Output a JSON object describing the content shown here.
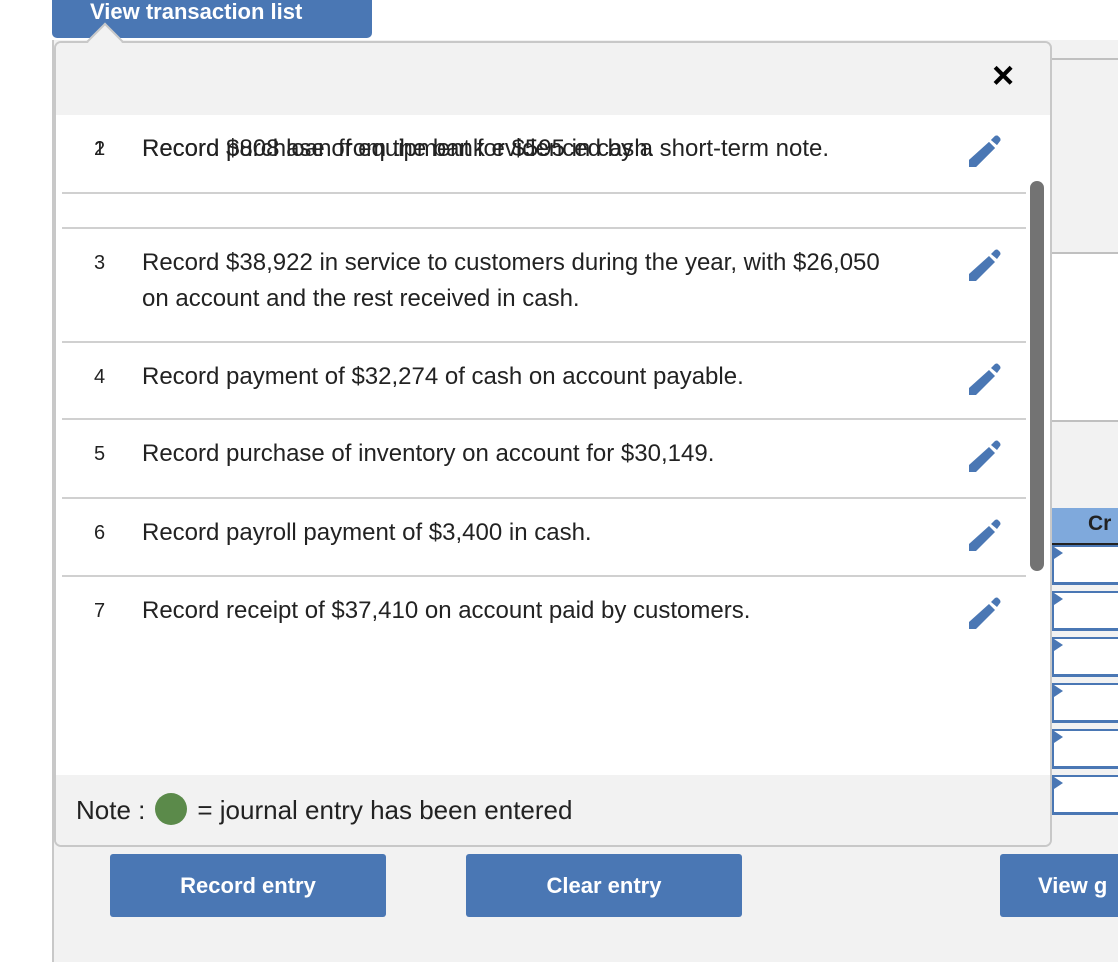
{
  "tab_button": "View transaction list",
  "popup": {
    "close_label": "×",
    "transactions": [
      {
        "num": "1",
        "text": "Record purchase of equipment for $595 in cash."
      },
      {
        "num": "2",
        "text": "Record $808 loan from the bank evidenced by a short-term note."
      },
      {
        "num": "3",
        "text": "Record $38,922 in service to customers during the year, with $26,050 on account and the rest received in cash."
      },
      {
        "num": "4",
        "text": "Record payment of $32,274 of cash on account payable."
      },
      {
        "num": "5",
        "text": "Record purchase of inventory on account for $30,149."
      },
      {
        "num": "6",
        "text": "Record payroll payment of $3,400 in cash."
      },
      {
        "num": "7",
        "text": "Record receipt of $37,410 on account paid by customers."
      }
    ],
    "note_label": "Note :",
    "note_text": "= journal entry has been entered",
    "note_color": "#5b8a4a"
  },
  "background": {
    "table_header": "Cr",
    "record_entry": "Record entry",
    "clear_entry": "Clear entry",
    "view_button": "View g"
  },
  "colors": {
    "accent": "#4a77b4",
    "header_blue": "#7fa9dc"
  }
}
